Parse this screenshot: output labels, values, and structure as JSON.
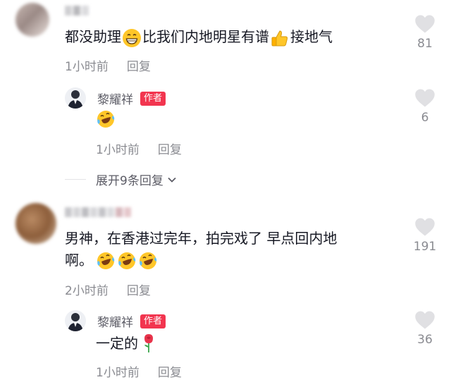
{
  "comments": [
    {
      "text": "都没助理",
      "text2": "比我们内地明星有谱",
      "text3": "接地气",
      "time": "1小时前",
      "reply_label": "回复",
      "likes": "81",
      "author_reply": {
        "name": "黎耀祥",
        "badge": "作者",
        "time": "1小时前",
        "reply_label": "回复",
        "likes": "6"
      },
      "expand_label": "展开9条回复"
    },
    {
      "text": "男神，在香港过完年，拍完戏了 早点回内地",
      "text_line2": "啊。",
      "time": "2小时前",
      "reply_label": "回复",
      "likes": "191",
      "author_reply": {
        "name": "黎耀祥",
        "badge": "作者",
        "text": "一定的",
        "time": "1小时前",
        "reply_label": "回复",
        "likes": "36"
      }
    }
  ],
  "icons": {
    "heart": "heart-icon",
    "grin": "grinning-emoji-icon",
    "thumbs": "thumbs-up-emoji-icon",
    "laugh": "laughing-tears-emoji-icon",
    "rose": "rose-emoji-icon",
    "chevron": "chevron-down-icon"
  },
  "colors": {
    "badge": "#f2354f",
    "meta": "#8a8b91",
    "heart": "#e0e0e3"
  }
}
